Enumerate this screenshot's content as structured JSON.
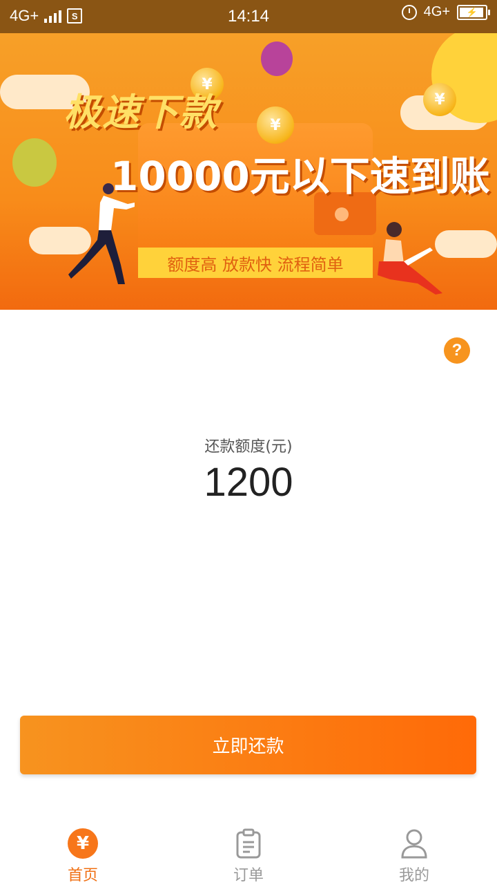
{
  "status_bar": {
    "network_left": "4G+",
    "sim_label": "S",
    "time": "14:14",
    "network_right": "4G+"
  },
  "banner": {
    "headline": "极速下款",
    "subheadline": "10000元以下速到账",
    "slogan": "额度高 放款快 流程简单",
    "coin_symbol": "¥"
  },
  "help": {
    "symbol": "?"
  },
  "amount": {
    "label": "还款额度(元)",
    "value": "1200"
  },
  "repay_button": {
    "label": "立即还款"
  },
  "tabbar": {
    "items": [
      {
        "label": "首页",
        "icon": "yen-icon",
        "active": true
      },
      {
        "label": "订单",
        "icon": "clipboard-icon",
        "active": false
      },
      {
        "label": "我的",
        "icon": "user-icon",
        "active": false
      }
    ]
  },
  "colors": {
    "accent": "#f7761a",
    "status_bar": "#8a5514"
  }
}
